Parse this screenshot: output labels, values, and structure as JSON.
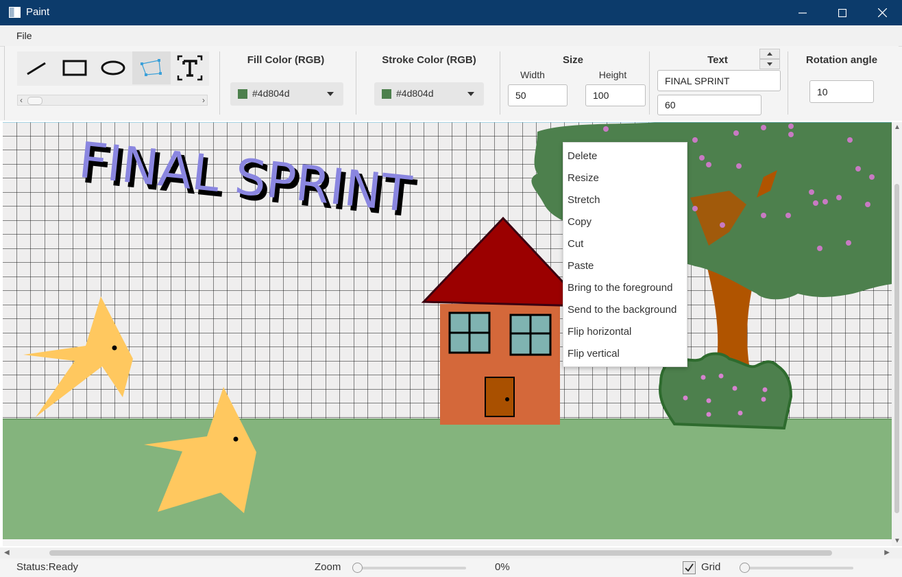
{
  "window": {
    "title": "Paint"
  },
  "menu": {
    "file": "File"
  },
  "toolbar": {
    "tools": [
      {
        "name": "line-tool-icon"
      },
      {
        "name": "rectangle-tool-icon"
      },
      {
        "name": "ellipse-tool-icon"
      },
      {
        "name": "polygon-tool-icon"
      },
      {
        "name": "text-tool-icon"
      }
    ],
    "fill_color": {
      "label": "Fill Color (RGB)",
      "value": "#4d804d"
    },
    "stroke_color": {
      "label": "Stroke Color (RGB)",
      "value": "#4d804d"
    },
    "size": {
      "label": "Size",
      "width_label": "Width",
      "width_value": "50",
      "height_label": "Height",
      "height_value": "100"
    },
    "text": {
      "label": "Text",
      "value": "FINAL SPRINT",
      "font_size": "60"
    },
    "rotation": {
      "label": "Rotation angle",
      "value": "10"
    }
  },
  "canvas": {
    "text": "FINAL SPRINT",
    "colors": {
      "grass": "#84b47d",
      "star": "#ffc85f",
      "roof": "#9b0000",
      "wall": "#d4683a",
      "tree": "#4d804d",
      "trunk": "#b05400",
      "text": "#8a86e0"
    }
  },
  "context_menu": {
    "items": [
      "Delete",
      "Resize",
      "Stretch",
      "Copy",
      "Cut",
      "Paste",
      "Bring to the foreground",
      "Send to the background",
      "Flip horizontal",
      "Flip vertical"
    ]
  },
  "status": {
    "status": "Status:Ready",
    "zoom_label": "Zoom",
    "zoom_value": "0%",
    "grid_label": "Grid",
    "grid_checked": true
  }
}
